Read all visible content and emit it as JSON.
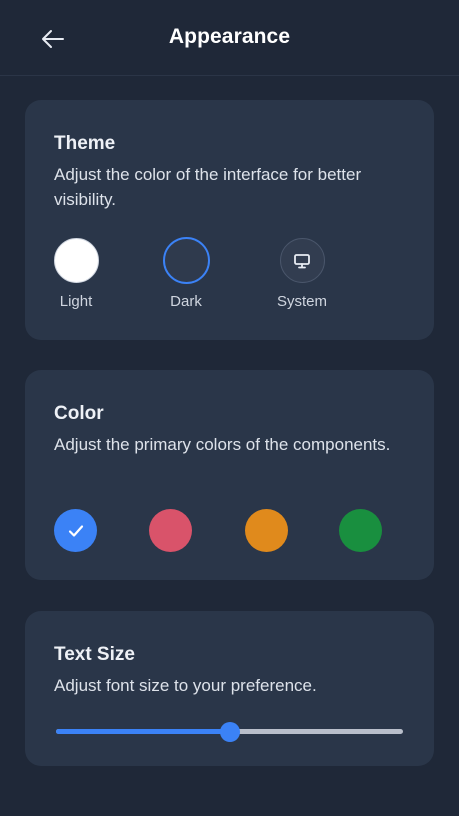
{
  "header": {
    "title": "Appearance",
    "back_icon": "arrow-left-icon"
  },
  "theme": {
    "title": "Theme",
    "description": "Adjust the color of the interface for better visibility.",
    "options": [
      {
        "label": "Light",
        "swatch": "#ffffff"
      },
      {
        "label": "Dark",
        "swatch": "#2f3a4d",
        "selected": true,
        "ring": "#3b82f6"
      },
      {
        "label": "System",
        "icon": "monitor-icon"
      }
    ]
  },
  "color": {
    "title": "Color",
    "description": "Adjust the primary colors of the components.",
    "swatches": [
      {
        "hex": "#3b82f6",
        "selected": true,
        "icon": "check-icon"
      },
      {
        "hex": "#d9536a"
      },
      {
        "hex": "#e08a1c"
      },
      {
        "hex": "#198f3f"
      }
    ]
  },
  "text_size": {
    "title": "Text Size",
    "description": "Adjust font size to your preference.",
    "slider_value": 0.5
  }
}
